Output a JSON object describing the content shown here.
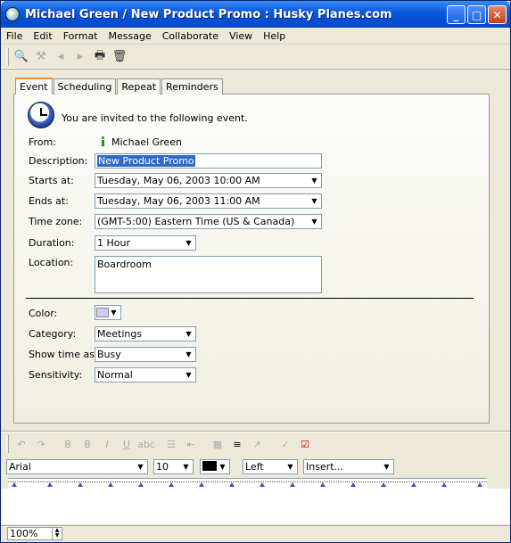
{
  "window": {
    "title": "Michael Green / New Product Promo : Husky Planes.com"
  },
  "menus": [
    "File",
    "Edit",
    "Format",
    "Message",
    "Collaborate",
    "View",
    "Help"
  ],
  "tabs": [
    "Event",
    "Scheduling",
    "Repeat",
    "Reminders"
  ],
  "event": {
    "invite_text": "You are invited to the following event.",
    "from_label": "From:",
    "from_value": "Michael Green",
    "description_label": "Description:",
    "description_value": "New Product Promo",
    "starts_label": "Starts at:",
    "starts_value": "Tuesday, May 06, 2003 10:00 AM",
    "ends_label": "Ends at:",
    "ends_value": "Tuesday, May 06, 2003 11:00 AM",
    "timezone_label": "Time zone:",
    "timezone_value": "(GMT-5:00) Eastern Time (US & Canada)",
    "duration_label": "Duration:",
    "duration_value": "1 Hour",
    "location_label": "Location:",
    "location_value": "Boardroom",
    "color_label": "Color:",
    "color_value": "#ccccff",
    "category_label": "Category:",
    "category_value": "Meetings",
    "showtime_label": "Show time as:",
    "showtime_value": "Busy",
    "sensitivity_label": "Sensitivity:",
    "sensitivity_value": "Normal"
  },
  "format": {
    "font": "Arial",
    "size": "10",
    "align": "Left",
    "insert": "Insert..."
  },
  "status": {
    "zoom": "100%"
  }
}
